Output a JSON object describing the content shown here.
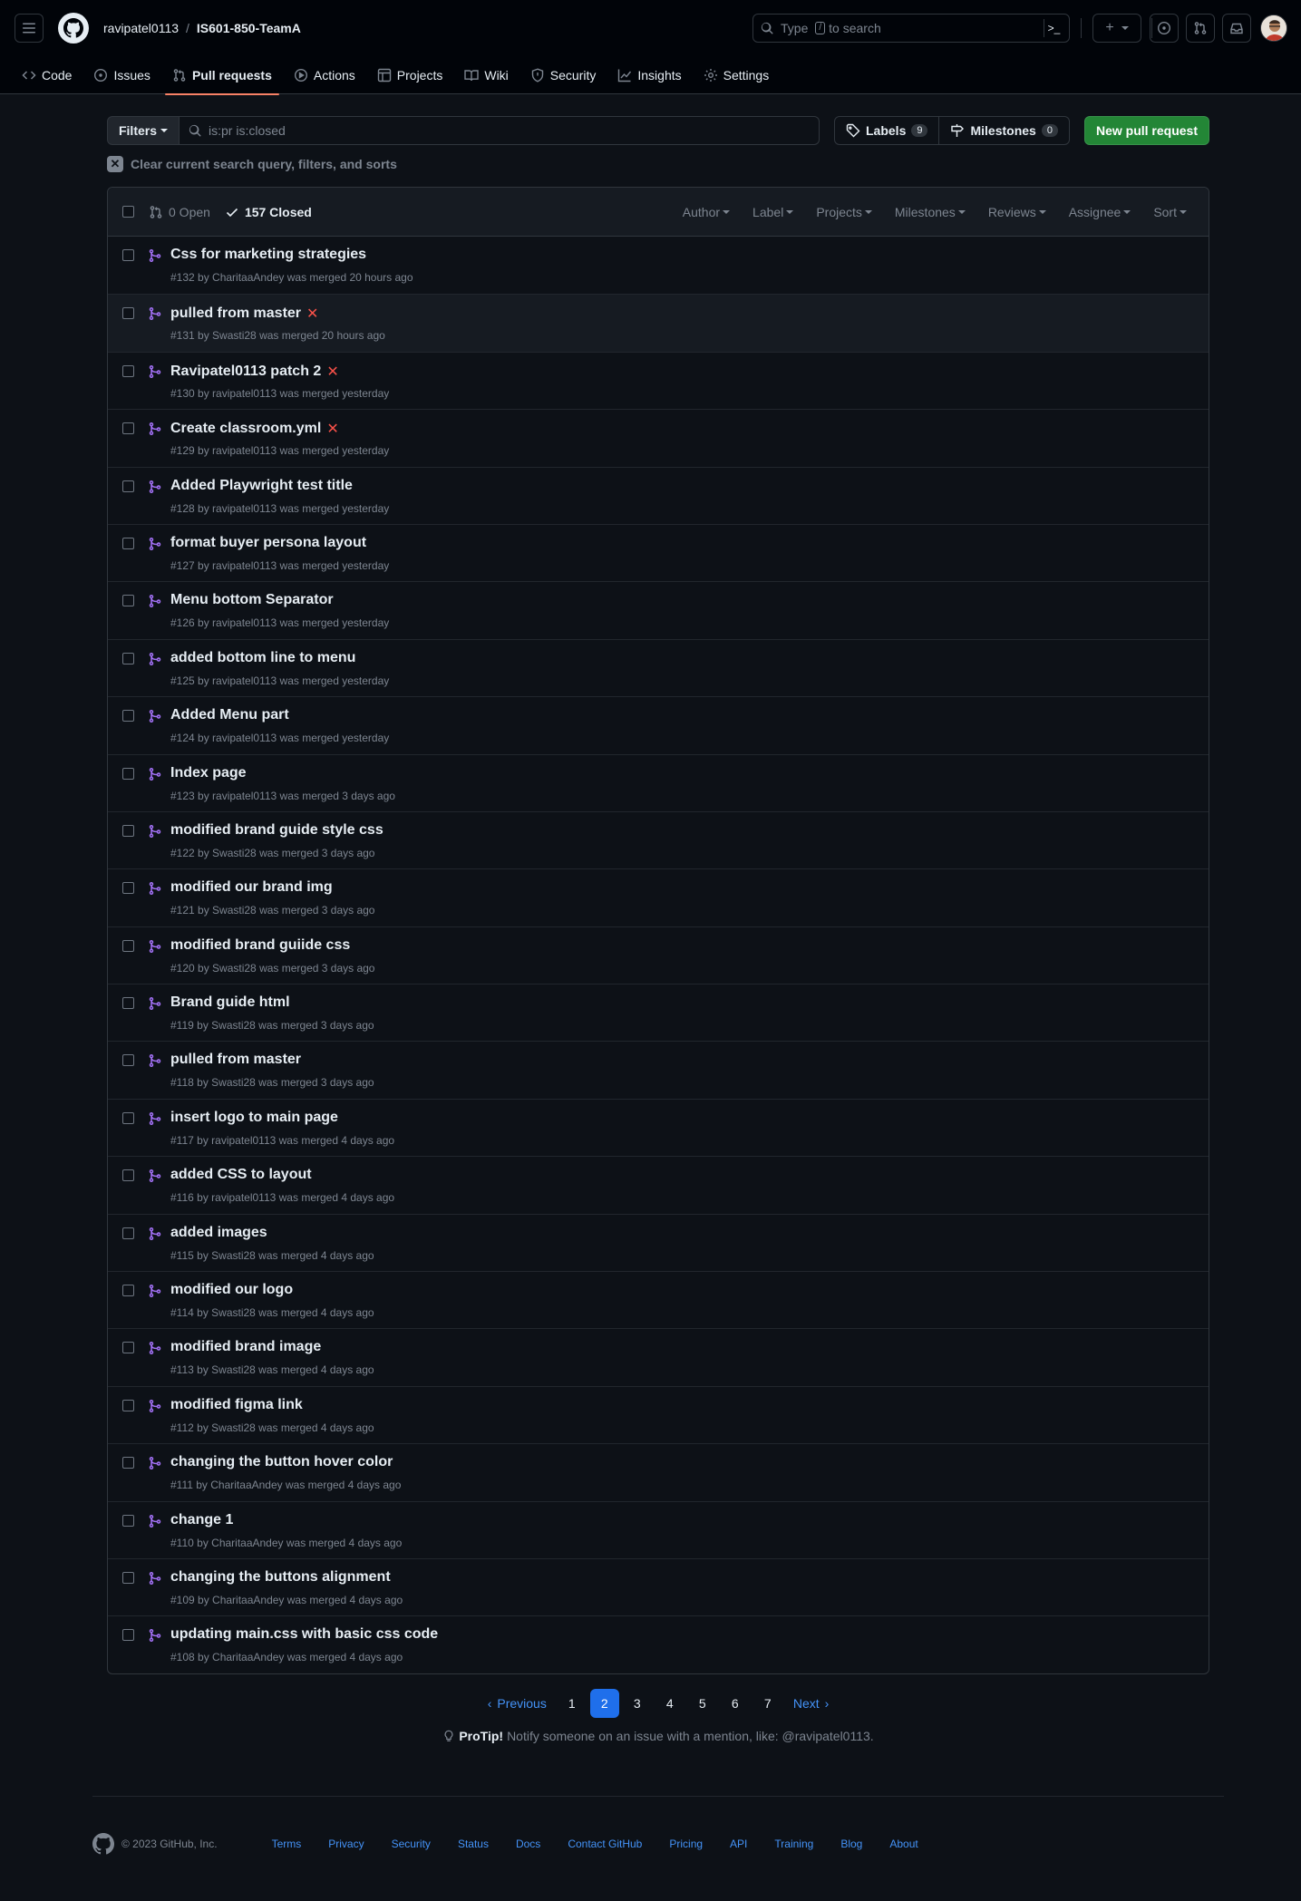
{
  "header": {
    "owner": "ravipatel0113",
    "separator": "/",
    "repo": "IS601-850-TeamA",
    "search_prefix": "Type",
    "search_key": "/",
    "search_suffix": "to search"
  },
  "tabs": [
    {
      "label": "Code",
      "icon": "code-icon"
    },
    {
      "label": "Issues",
      "icon": "issue-icon"
    },
    {
      "label": "Pull requests",
      "icon": "pull-request-icon"
    },
    {
      "label": "Actions",
      "icon": "play-icon"
    },
    {
      "label": "Projects",
      "icon": "table-icon"
    },
    {
      "label": "Wiki",
      "icon": "book-icon"
    },
    {
      "label": "Security",
      "icon": "shield-icon"
    },
    {
      "label": "Insights",
      "icon": "graph-icon"
    },
    {
      "label": "Settings",
      "icon": "gear-icon"
    }
  ],
  "toolbar": {
    "filters_label": "Filters",
    "query": "is:pr is:closed",
    "labels_label": "Labels",
    "labels_count": "9",
    "milestones_label": "Milestones",
    "milestones_count": "0",
    "new_pr_label": "New pull request",
    "clear_label": "Clear current search query, filters, and sorts"
  },
  "list_header": {
    "open_label": "0 Open",
    "closed_label": "157 Closed",
    "filters": [
      "Author",
      "Label",
      "Projects",
      "Milestones",
      "Reviews",
      "Assignee",
      "Sort"
    ]
  },
  "pulls": [
    {
      "title": "Css for marketing strategies",
      "meta": "#132 by CharitaaAndey was merged 20 hours ago",
      "failed": false
    },
    {
      "title": "pulled from master",
      "meta": "#131 by Swasti28 was merged 20 hours ago",
      "failed": true
    },
    {
      "title": "Ravipatel0113 patch 2",
      "meta": "#130 by ravipatel0113 was merged yesterday",
      "failed": true
    },
    {
      "title": "Create classroom.yml",
      "meta": "#129 by ravipatel0113 was merged yesterday",
      "failed": true
    },
    {
      "title": "Added Playwright test title",
      "meta": "#128 by ravipatel0113 was merged yesterday",
      "failed": false
    },
    {
      "title": "format buyer persona layout",
      "meta": "#127 by ravipatel0113 was merged yesterday",
      "failed": false
    },
    {
      "title": "Menu bottom Separator",
      "meta": "#126 by ravipatel0113 was merged yesterday",
      "failed": false
    },
    {
      "title": "added bottom line to menu",
      "meta": "#125 by ravipatel0113 was merged yesterday",
      "failed": false
    },
    {
      "title": "Added Menu part",
      "meta": "#124 by ravipatel0113 was merged yesterday",
      "failed": false
    },
    {
      "title": "Index page",
      "meta": "#123 by ravipatel0113 was merged 3 days ago",
      "failed": false
    },
    {
      "title": "modified brand guide style css",
      "meta": "#122 by Swasti28 was merged 3 days ago",
      "failed": false
    },
    {
      "title": "modified our brand img",
      "meta": "#121 by Swasti28 was merged 3 days ago",
      "failed": false
    },
    {
      "title": "modified brand guiide css",
      "meta": "#120 by Swasti28 was merged 3 days ago",
      "failed": false
    },
    {
      "title": "Brand guide html",
      "meta": "#119 by Swasti28 was merged 3 days ago",
      "failed": false
    },
    {
      "title": "pulled from master",
      "meta": "#118 by Swasti28 was merged 3 days ago",
      "failed": false
    },
    {
      "title": "insert logo to main page",
      "meta": "#117 by ravipatel0113 was merged 4 days ago",
      "failed": false
    },
    {
      "title": "added CSS to layout",
      "meta": "#116 by ravipatel0113 was merged 4 days ago",
      "failed": false
    },
    {
      "title": "added images",
      "meta": "#115 by Swasti28 was merged 4 days ago",
      "failed": false
    },
    {
      "title": "modified our logo",
      "meta": "#114 by Swasti28 was merged 4 days ago",
      "failed": false
    },
    {
      "title": "modified brand image",
      "meta": "#113 by Swasti28 was merged 4 days ago",
      "failed": false
    },
    {
      "title": "modified figma link",
      "meta": "#112 by Swasti28 was merged 4 days ago",
      "failed": false
    },
    {
      "title": "changing the button hover color",
      "meta": "#111 by CharitaaAndey was merged 4 days ago",
      "failed": false
    },
    {
      "title": "change 1",
      "meta": "#110 by CharitaaAndey was merged 4 days ago",
      "failed": false
    },
    {
      "title": "changing the buttons alignment",
      "meta": "#109 by CharitaaAndey was merged 4 days ago",
      "failed": false
    },
    {
      "title": "updating main.css with basic css code",
      "meta": "#108 by CharitaaAndey was merged 4 days ago",
      "failed": false
    }
  ],
  "pagination": {
    "previous": "Previous",
    "next": "Next",
    "pages": [
      "1",
      "2",
      "3",
      "4",
      "5",
      "6",
      "7"
    ],
    "current": "2"
  },
  "protip": {
    "label": "ProTip!",
    "text": "Notify someone on an issue with a mention, like: @ravipatel0113."
  },
  "footer": {
    "copyright": "© 2023 GitHub, Inc.",
    "links": [
      "Terms",
      "Privacy",
      "Security",
      "Status",
      "Docs",
      "Contact GitHub",
      "Pricing",
      "API",
      "Training",
      "Blog",
      "About"
    ]
  },
  "colors": {
    "accent": "#1f6feb",
    "merged": "#a371f7",
    "failure": "#f85149",
    "new_pr": "#238636",
    "active_tab": "#f78166"
  }
}
